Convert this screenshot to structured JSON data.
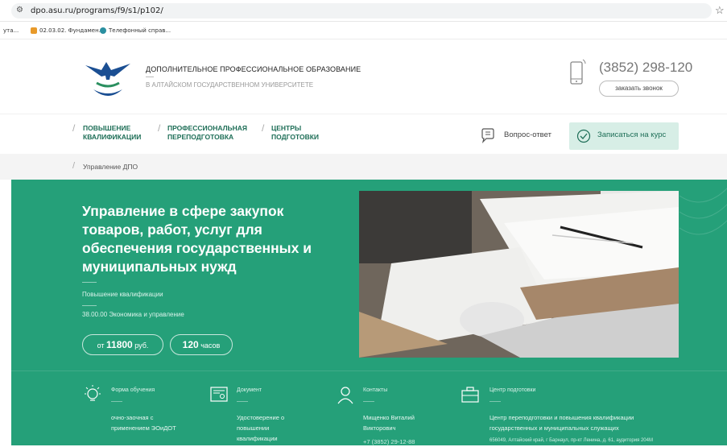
{
  "browser": {
    "url": "dpo.asu.ru/programs/f9/s1/p102/",
    "bookmarks": [
      "ута...",
      "02.03.02. Фундамен...",
      "Телефонный справ..."
    ]
  },
  "header": {
    "title": "ДОПОЛНИТЕЛЬНОЕ ПРОФЕССИОНАЛЬНОЕ ОБРАЗОВАНИЕ",
    "subtitle": "В АЛТАЙСКОМ ГОСУДАРСТВЕННОМ УНИВЕРСИТЕТЕ",
    "phone": "(3852) 298-120",
    "callback": "заказать звонок"
  },
  "nav": {
    "items": [
      {
        "line1": "ПОВЫШЕНИЕ",
        "line2": "КВАЛИФИКАЦИИ"
      },
      {
        "line1": "ПРОФЕССИОНАЛЬНАЯ",
        "line2": "ПЕРЕПОДГОТОВКА"
      },
      {
        "line1": "ЦЕНТРЫ",
        "line2": "ПОДГОТОВКИ"
      }
    ],
    "faq": "Вопрос-ответ",
    "enroll": "Записаться на курс"
  },
  "breadcrumb": "Управление ДПО",
  "hero": {
    "title": "Управление в сфере закупок товаров, работ, услуг для обеспечения государственных и муниципальных нужд",
    "type": "Повышение квалификации",
    "code": "38.00.00 Экономика и управление",
    "price_prefix": "от",
    "price_value": "11800",
    "price_unit": "руб.",
    "hours_value": "120",
    "hours_unit": "часов"
  },
  "info": [
    {
      "title": "Форма обучения",
      "text1": "очно-заочная с",
      "text2": "применением ЭОиДОТ",
      "text3": "",
      "icon": "lightbulb-icon"
    },
    {
      "title": "Документ",
      "text1": "Удостоверение о",
      "text2": "повышении",
      "text3": "квалификации",
      "icon": "certificate-icon"
    },
    {
      "title": "Контакты",
      "text1": "Мищенко Виталий",
      "text2": "Викторович",
      "text3": "+7 (3852) 29-12-88",
      "icon": "person-icon"
    },
    {
      "title": "Центр подготовки",
      "text1": "Центр переподготовки и повышения квалификации",
      "text2": "государственных и муниципальных служащих",
      "text3": "656049, Алтайский край, г Барнаул, пр-кт Ленина, д. 61, аудитория 204М",
      "icon": "briefcase-icon"
    }
  ],
  "colors": {
    "brand_green": "#25a079",
    "nav_green": "#1e6e57",
    "enroll_bg": "#d7eee6"
  }
}
